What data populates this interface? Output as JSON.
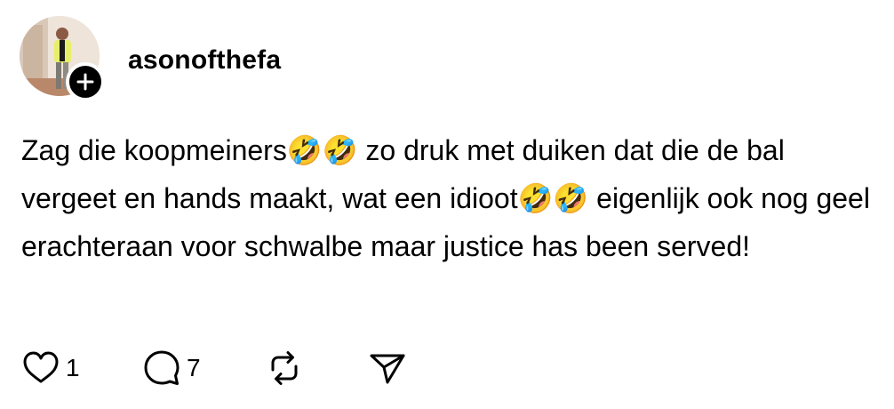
{
  "post": {
    "username": "asonofthefa",
    "text": "Zag die koopmeiners🤣🤣 zo druk met duiken dat die de bal vergeet en hands maakt, wat een idioot🤣🤣 eigenlijk ook nog geel erachteraan voor schwalbe maar justice has been served!",
    "avatar_icon": "profile-photo",
    "follow_icon": "plus-icon"
  },
  "actions": {
    "like_count": "1",
    "comment_count": "7",
    "like_icon": "heart-icon",
    "comment_icon": "comment-icon",
    "repost_icon": "repost-icon",
    "share_icon": "send-icon"
  }
}
